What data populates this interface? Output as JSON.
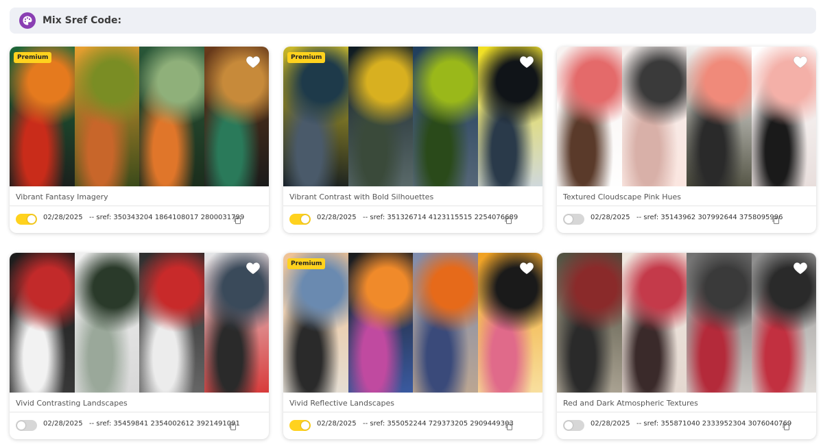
{
  "header": {
    "title": "Mix Sref Code:",
    "icon": "palette-icon"
  },
  "cards": [
    {
      "title": "Vibrant Fantasy Imagery",
      "date": "02/28/2025",
      "sref": "-- sref: 350343204 1864108017 2800031799",
      "premium": "Premium",
      "toggle_on": true,
      "strips": [
        "#1d6b3a,#e57a1e,#c92c1a,#1b1b1b",
        "#e8a030,#7a8d24,#c8662a,#3a4a1a",
        "#2a5a3a,#8fb07a,#e0762a,#1a2a1a",
        "#6a3a1a,#c78a3a,#2a7a5a,#1a1a1a"
      ]
    },
    {
      "title": "Vibrant Contrast with Bold Silhouettes",
      "date": "02/28/2025",
      "sref": "-- sref: 351326714 4123115515 2254076689",
      "premium": "Premium",
      "toggle_on": true,
      "strips": [
        "#d8c42a,#1e3a4a,#4a5a6a,#101820",
        "#0e1a20,#d8b020,#3a4a3a,#5a6a6a",
        "#1a3a5a,#9ab81a,#2a4a1a,#5a6a7a",
        "#f2e01e,#101418,#2a3a4a,#cfd8dc"
      ]
    },
    {
      "title": "Textured Cloudscape Pink Hues",
      "date": "02/28/2025",
      "sref": "-- sref: 35143962 307992644 3758095996",
      "premium": "",
      "toggle_on": false,
      "strips": [
        "#f7f2f0,#e46a6a,#5a3a2a,#ffffff",
        "#f4eeec,#3a3a3a,#d8b0a8,#fbe6e0",
        "#ffffff,#f08a7a,#2a2a2a,#4a4a3a",
        "#ffffff,#f4b0a8,#1a1a1a,#e8dedc"
      ]
    },
    {
      "title": "Vivid Contrasting Landscapes",
      "date": "02/28/2025",
      "sref": "-- sref: 35459841 2354002612 3921491091",
      "premium": "",
      "toggle_on": false,
      "strips": [
        "#1a1a1a,#c22a2a,#f2f2f2,#3a3a3a",
        "#f0f0f0,#2a3a2a,#9aa89a,#d8d8d8",
        "#2a2a2a,#c82a2a,#ececec,#6a6a6a",
        "#e4e8ea,#3a4a5a,#2a2a2a,#d83a3a"
      ]
    },
    {
      "title": "Vivid Reflective Landscapes",
      "date": "02/28/2025",
      "sref": "-- sref: 355052244 729373205 2909449303",
      "premium": "Premium",
      "toggle_on": true,
      "strips": [
        "#f0c090,#6a8ab0,#2a2a2a,#e4e0d8",
        "#1a1a1a,#f08a2a,#c04aa0,#3a5aa0",
        "#7a8ab0,#e66a1a,#3a4a7a,#c0a890",
        "#f0a020,#1a1a1a,#e06a8a,#f8e0a0"
      ]
    },
    {
      "title": "Red and Dark Atmospheric Textures",
      "date": "02/28/2025",
      "sref": "-- sref: 355871040 2333952304 3076040769",
      "premium": "",
      "toggle_on": false,
      "strips": [
        "#4a4a3a,#8a2a2a,#2a2a2a,#b0a898",
        "#f0e8e0,#c43a4a,#3a2a2a,#e4d8d0",
        "#6a6a6a,#3a3a3a,#b42a3a,#d0ccc8",
        "#8a8a8a,#2a2a2a,#c23040,#e0dcd8"
      ]
    }
  ]
}
